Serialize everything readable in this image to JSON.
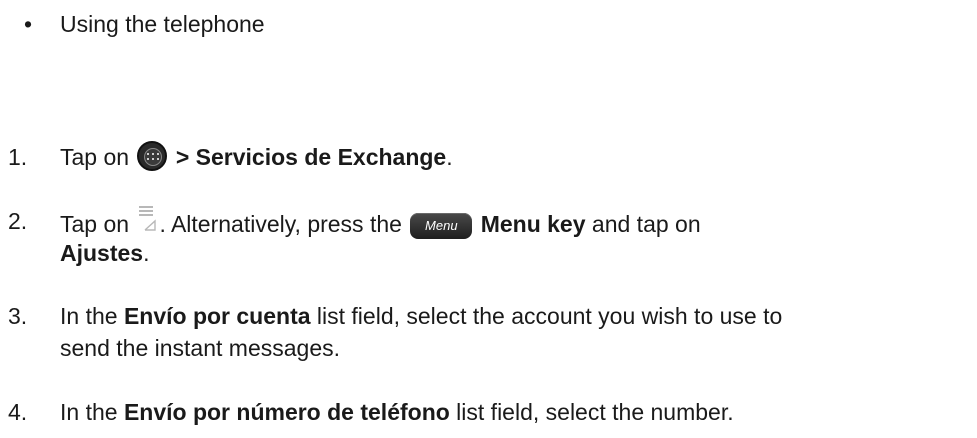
{
  "bullet": {
    "symbol": "•",
    "text": "Using the telephone"
  },
  "steps": [
    {
      "number": "1.",
      "prefix": "Tap on ",
      "icon": "apps-grid-icon",
      "bold": " > Servicios de Exchange",
      "suffix": "."
    },
    {
      "number": "2.",
      "prefix": "Tap on ",
      "icon": "settings-menu-icon",
      "middle": ". Alternatively, press the ",
      "key_label": "Menu",
      "bold1": " Menu key",
      "middle2": " and tap on",
      "line2_bold": "Ajustes",
      "line2_suffix": "."
    },
    {
      "number": "3.",
      "prefix": "In the ",
      "bold": "Envío por cuenta",
      "suffix": " list field, select the account you wish to use to",
      "line2": "send the instant messages."
    },
    {
      "number": "4.",
      "prefix": "In the ",
      "bold": "Envío por número de teléfono",
      "suffix": " list field, select the number."
    }
  ]
}
